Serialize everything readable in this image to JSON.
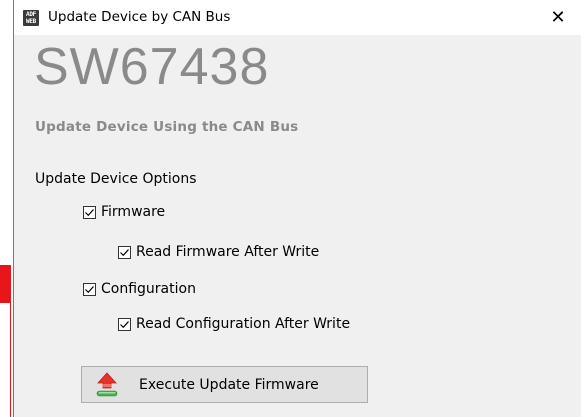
{
  "window": {
    "title": "Update Device by CAN Bus",
    "icon_lines": [
      "ADF",
      "WEB"
    ],
    "close_glyph": "✕"
  },
  "header": {
    "app_name": "SW67438",
    "subtitle": "Update Device Using the CAN Bus"
  },
  "options": {
    "section_title": "Update Device Options",
    "firmware": {
      "label": "Firmware",
      "checked": true
    },
    "read_firmware": {
      "label": "Read Firmware After Write",
      "checked": true
    },
    "configuration": {
      "label": "Configuration",
      "checked": true
    },
    "read_configuration": {
      "label": "Read Configuration After Write",
      "checked": true
    }
  },
  "actions": {
    "execute_label": "Execute Update Firmware",
    "execute_icon": "upload-arrow-icon"
  },
  "colors": {
    "title_text": "#000000",
    "brand_gray": "#8a8a8a",
    "content_bg": "#f0f0f0",
    "window_accent": "#1d9fb0",
    "background_red": "#e8161b",
    "icon_red": "#e8312a",
    "icon_green": "#3db54a"
  }
}
